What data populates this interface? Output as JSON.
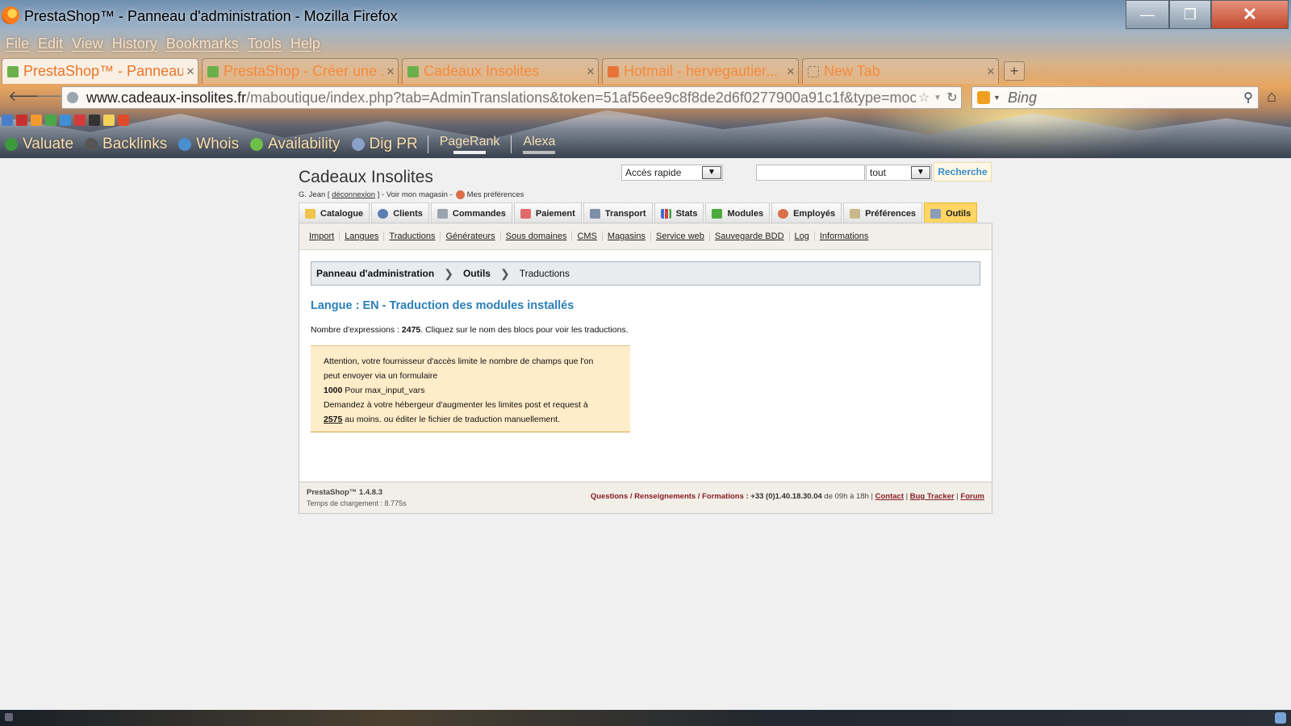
{
  "browser": {
    "window_title": "PrestaShop™ - Panneau d'administration - Mozilla Firefox",
    "menu": [
      "File",
      "Edit",
      "View",
      "History",
      "Bookmarks",
      "Tools",
      "Help"
    ],
    "tabs": [
      {
        "label": "PrestaShop™ - Panneau ...",
        "active": true
      },
      {
        "label": "PrestaShop - Créer une ...",
        "active": false
      },
      {
        "label": "Cadeaux Insolites",
        "active": false
      },
      {
        "label": "Hotmail - hervegautier...",
        "active": false
      },
      {
        "label": "New Tab",
        "active": false
      }
    ],
    "url_domain": "www.cadeaux-insolites.fr",
    "url_path": "/maboutique/index.php?tab=AdminTranslations&token=51af56ee9c8f8de2d6f0277900a91c1f&type=moc",
    "search_engine_placeholder": "Bing",
    "seo_toolbar": {
      "items": [
        "Valuate",
        "Backlinks",
        "Whois",
        "Availability",
        "Dig PR"
      ],
      "meters": [
        "PageRank",
        "Alexa"
      ]
    }
  },
  "header": {
    "shop_name": "Cadeaux Insolites",
    "user_prefix": "G. Jean [",
    "logout_label": "déconnexion",
    "user_middle": "] - Voir mon magasin -",
    "preferences_label": "Mes préférences",
    "quick_access_value": "Accès rapide",
    "search_value": "",
    "scope_value": "tout",
    "search_button": "Recherche"
  },
  "main_tabs": [
    {
      "label": "Catalogue",
      "icon": "folder-icon",
      "active": false
    },
    {
      "label": "Clients",
      "icon": "user-icon",
      "active": false
    },
    {
      "label": "Commandes",
      "icon": "cart-icon",
      "active": false
    },
    {
      "label": "Paiement",
      "icon": "payment-icon",
      "active": false
    },
    {
      "label": "Transport",
      "icon": "truck-icon",
      "active": false
    },
    {
      "label": "Stats",
      "icon": "chart-icon",
      "active": false
    },
    {
      "label": "Modules",
      "icon": "puzzle-icon",
      "active": false
    },
    {
      "label": "Employés",
      "icon": "employee-icon",
      "active": false
    },
    {
      "label": "Préférences",
      "icon": "preferences-icon",
      "active": false
    },
    {
      "label": "Outils",
      "icon": "wrench-icon",
      "active": true
    }
  ],
  "sub_nav": [
    "Import",
    "Langues",
    "Traductions",
    "Générateurs",
    "Sous domaines",
    "CMS",
    "Magasins",
    "Service web",
    "Sauvegarde BDD",
    "Log",
    "Informations"
  ],
  "breadcrumb": [
    "Panneau d'administration",
    "Outils",
    "Traductions"
  ],
  "content": {
    "heading": "Langue : EN - Traduction des modules installés",
    "count_prefix": "Nombre d'expressions :",
    "count_value": "2475",
    "count_suffix": ". Cliquez sur le nom des blocs pour voir les traductions.",
    "warning": {
      "line1": "Attention, votre fournisseur d'accès limite le nombre de champs que l'on",
      "line2": "peut envoyer via un formulaire",
      "limit_value": "1000",
      "limit_label": "Pour max_input_vars",
      "line4": "Demandez à votre hébergeur d'augmenter les limites post et request à",
      "required_value": "2575",
      "line5_suffix": "au moins. ou éditer le fichier de traduction manuellement."
    }
  },
  "footer": {
    "version": "PrestaShop™ 1.4.8.3",
    "load_time": "Temps de chargement : 8.775s",
    "questions": "Questions / Renseignements / Formations :",
    "phone": "+33 (0)1.40.18.30.04",
    "hours": "de 09h à 18h |",
    "contact": "Contact",
    "bug_tracker": "Bug Tracker",
    "forum": "Forum"
  },
  "colors": {
    "active_tab": "#ffd563",
    "heading_blue": "#2a7fb8",
    "warning_bg": "#ffecc9",
    "footer_accent": "#8b1e24"
  }
}
